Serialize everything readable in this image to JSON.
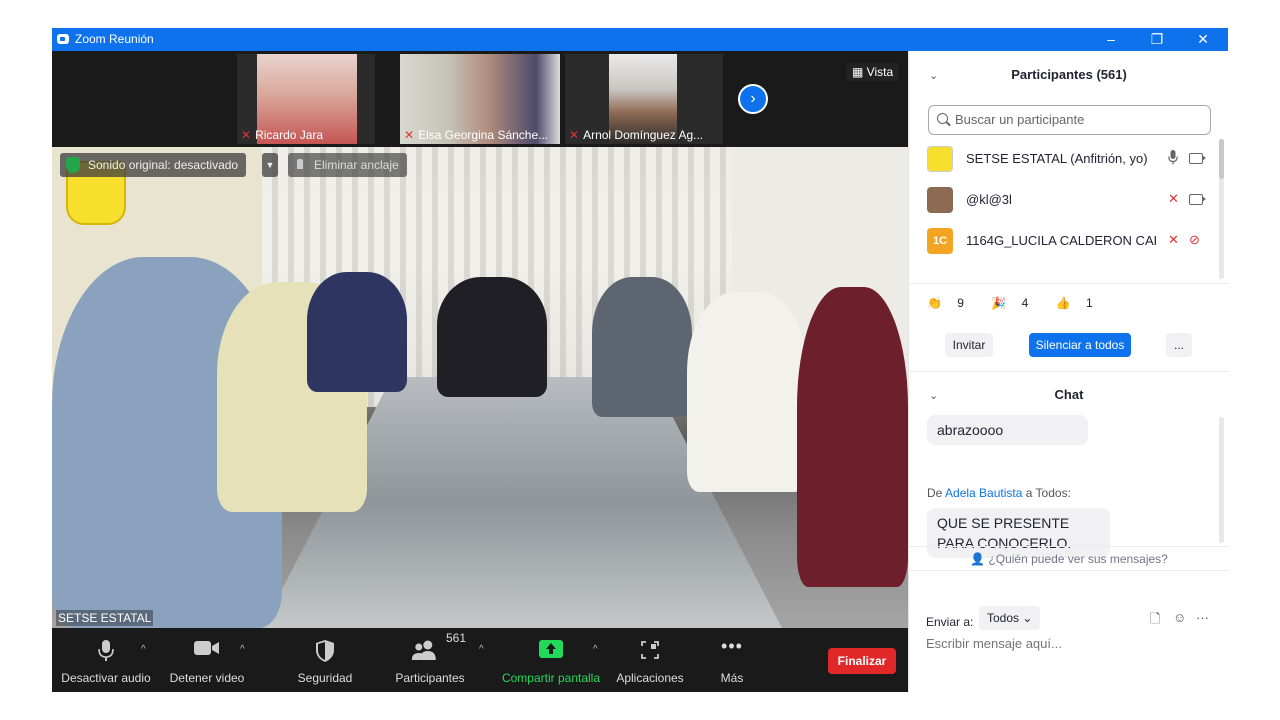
{
  "window": {
    "title": "Zoom Reunión"
  },
  "thumbnails": [
    {
      "name": "Ricardo Jara"
    },
    {
      "name": "Elsa Georgina Sánche..."
    },
    {
      "name": "Arnol Domínguez Ag..."
    }
  ],
  "view_label": "Vista",
  "main_video": {
    "original_sound": "Sonido original: desactivado",
    "unpin": "Eliminar anclaje",
    "speaker": "SETSE ESTATAL"
  },
  "toolbar": {
    "audio": "Desactivar audio",
    "video": "Detener video",
    "security": "Seguridad",
    "participants": "Participantes",
    "participants_count": "561",
    "share": "Compartir pantalla",
    "apps": "Aplicaciones",
    "more": "Más",
    "end": "Finalizar"
  },
  "participants_panel": {
    "title": "Participantes (561)",
    "search_placeholder": "Buscar un participante",
    "participants": [
      {
        "name": "SETSE ESTATAL (Anfitrión, yo)",
        "avatar": ""
      },
      {
        "name": "@kl@3l",
        "avatar": ""
      },
      {
        "name": "1164G_LUCILA CALDERON CAR...",
        "avatar": "1C"
      }
    ],
    "reactions": [
      {
        "icon": "👏",
        "count": "9"
      },
      {
        "icon": "🎉",
        "count": "4"
      },
      {
        "icon": "👍",
        "count": "1"
      }
    ],
    "invite": "Invitar",
    "mute_all": "Silenciar a todos",
    "more": "..."
  },
  "chat": {
    "title": "Chat",
    "prev_message": "abrazoooo",
    "from_prefix": "De",
    "from_name": "Adela Bautista",
    "from_to": "a Todos:",
    "message": "QUE SE PRESENTE PARA CONOCERLO.",
    "who_can_see": "¿Quién puede ver sus mensajes?",
    "send_to_label": "Enviar a:",
    "send_to_value": "Todos",
    "input_placeholder": "Escribir mensaje aquí..."
  },
  "colors": {
    "accent": "#0e72ed",
    "end": "#e02828",
    "share": "#23d959",
    "muted": "#e0332f"
  }
}
